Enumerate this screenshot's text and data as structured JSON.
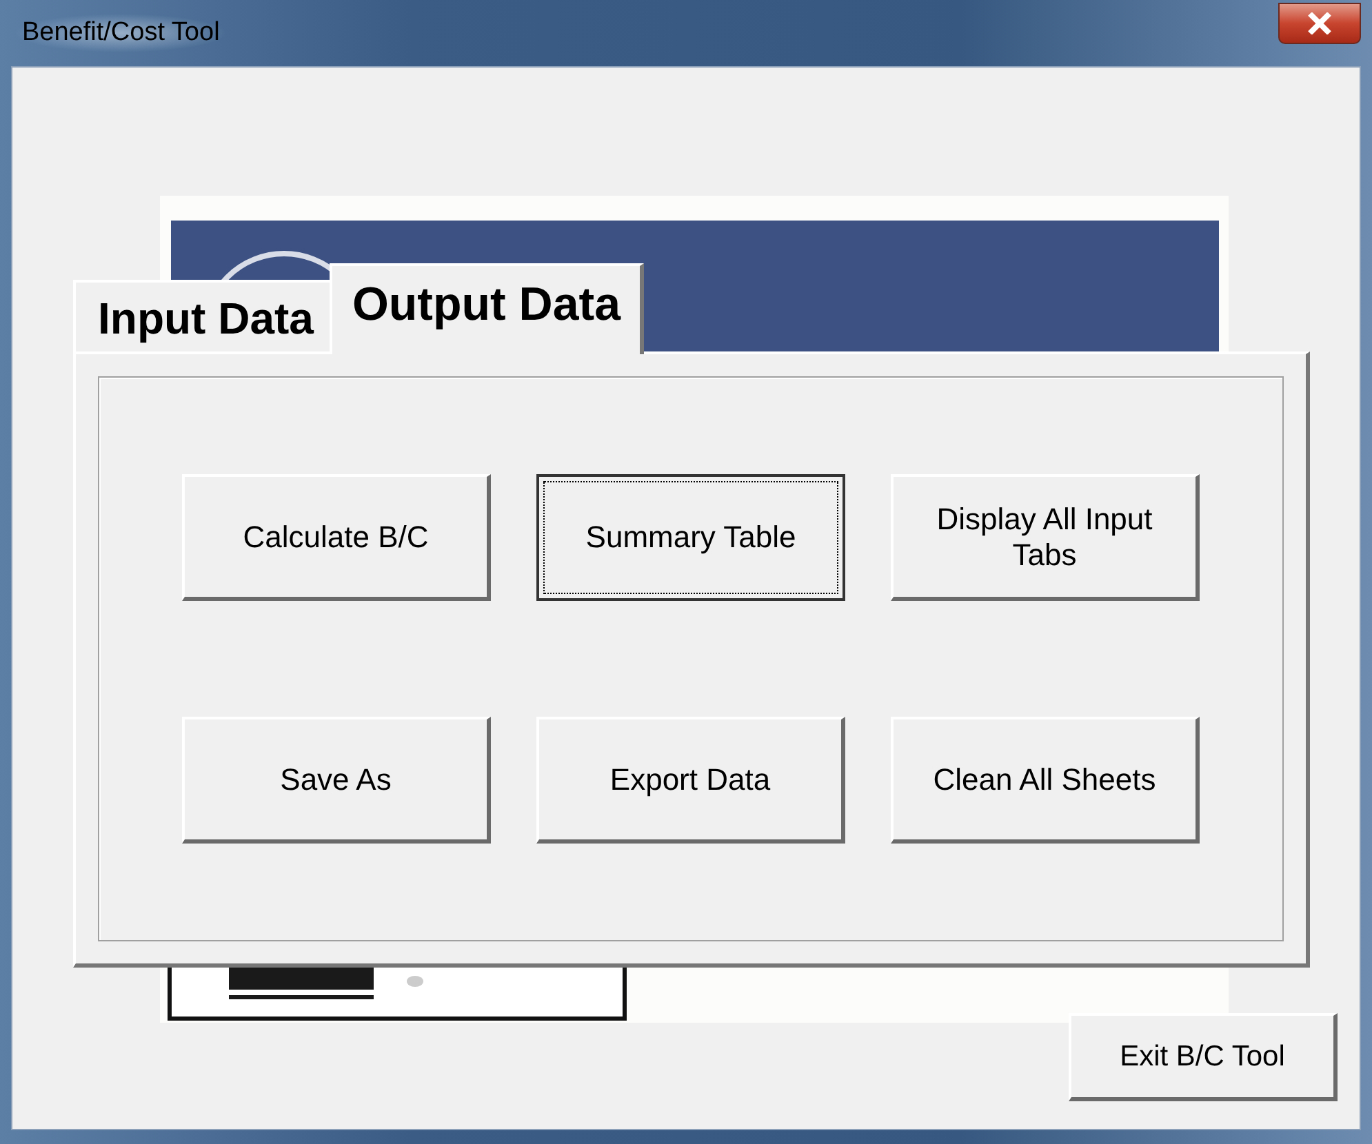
{
  "window": {
    "title": "Benefit/Cost Tool"
  },
  "tabs": [
    {
      "label": "Input Data",
      "selected": false
    },
    {
      "label": "Output Data",
      "selected": true
    }
  ],
  "buttons": [
    {
      "label": "Calculate B/C",
      "focused": false
    },
    {
      "label": "Summary Table",
      "focused": true
    },
    {
      "label": "Display All Input Tabs",
      "focused": false
    },
    {
      "label": "Save As",
      "focused": false
    },
    {
      "label": "Export Data",
      "focused": false
    },
    {
      "label": "Clean All Sheets",
      "focused": false
    }
  ],
  "exit_button": {
    "label": "Exit B/C Tool"
  }
}
